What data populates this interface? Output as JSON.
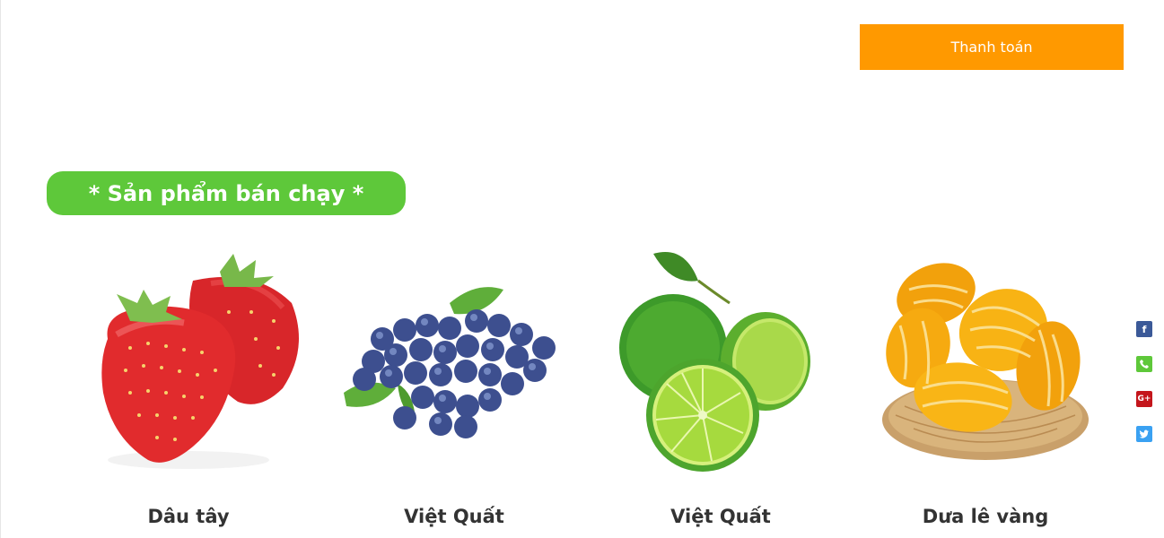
{
  "header": {
    "checkout_label": "Thanh toán"
  },
  "section": {
    "title": "* Sản phẩm bán chạy *"
  },
  "products": [
    {
      "name": "Dâu tây",
      "image": "strawberry"
    },
    {
      "name": "Việt Quất",
      "image": "blueberry"
    },
    {
      "name": "Việt Quất",
      "image": "lime"
    },
    {
      "name": "Dưa lê vàng",
      "image": "yellow-melon"
    }
  ],
  "social": [
    {
      "icon": "facebook-icon",
      "color": "#3b5998"
    },
    {
      "icon": "phone-icon",
      "color": "#5ec83a"
    },
    {
      "icon": "google-plus-icon",
      "color": "#c4161c"
    },
    {
      "icon": "twitter-icon",
      "color": "#3aa1f2"
    }
  ]
}
